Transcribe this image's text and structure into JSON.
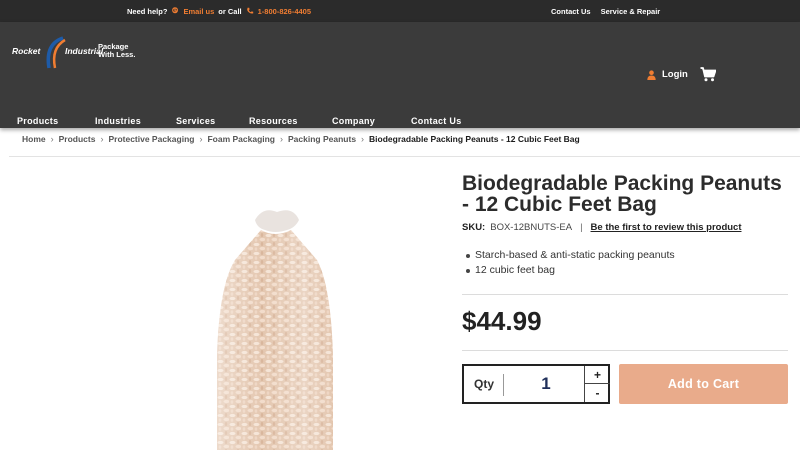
{
  "topbar": {
    "need_help": "Need help?",
    "email_label": "Email us",
    "or_call": "or Call",
    "phone": "1-800-826-4405",
    "contact_us": "Contact Us",
    "service_repair": "Service & Repair"
  },
  "logo": {
    "rocket": "Rocket",
    "industrial": "Industrial",
    "tagline_1": "Package",
    "tagline_2": "With Less."
  },
  "header": {
    "login_label": "Login",
    "cart_icon": "cart-icon",
    "user_icon": "user-icon"
  },
  "nav": {
    "items": [
      {
        "label": "Products"
      },
      {
        "label": "Industries"
      },
      {
        "label": "Services"
      },
      {
        "label": "Resources"
      },
      {
        "label": "Company"
      },
      {
        "label": "Contact Us"
      }
    ]
  },
  "breadcrumb": {
    "items": [
      {
        "label": "Home"
      },
      {
        "label": "Products"
      },
      {
        "label": "Protective Packaging"
      },
      {
        "label": "Foam Packaging"
      },
      {
        "label": "Packing Peanuts"
      }
    ],
    "current": "Biodegradable Packing Peanuts - 12 Cubic Feet Bag"
  },
  "product": {
    "title": "Biodegradable Packing Peanuts - 12 Cubic Feet Bag",
    "sku_label": "SKU:",
    "sku": "BOX-12BNUTS-EA",
    "separator": "|",
    "review_link": "Be the first to review this product",
    "features": [
      "Starch-based & anti-static packing peanuts",
      "12 cubic feet bag"
    ],
    "price": "$44.99"
  },
  "cart_form": {
    "qty_label": "Qty",
    "qty_value": "1",
    "plus": "+",
    "minus": "-",
    "add_to_cart": "Add to Cart"
  },
  "colors": {
    "accent_orange": "#f07d32",
    "header_bg": "#3b3b3b",
    "topbar_bg": "#2b2b2b",
    "add_to_cart_bg": "#e9ab8b"
  }
}
